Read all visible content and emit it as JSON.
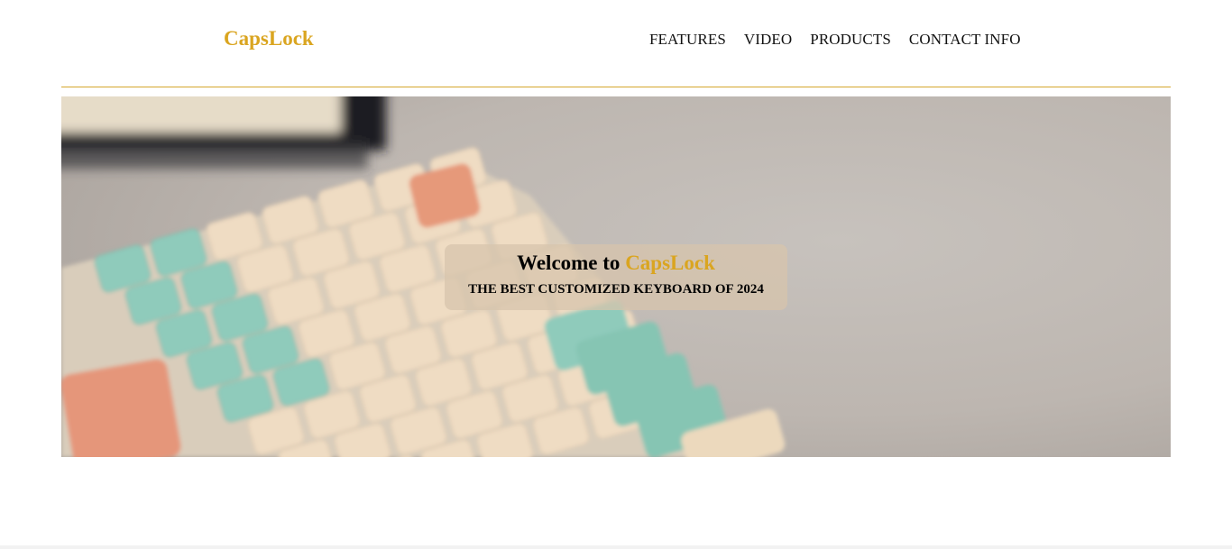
{
  "header": {
    "logo": "CapsLock",
    "nav": [
      {
        "label": "FEATURES"
      },
      {
        "label": "VIDEO"
      },
      {
        "label": "PRODUCTS"
      },
      {
        "label": "CONTACT INFO"
      }
    ]
  },
  "hero": {
    "title_prefix": "Welcome to",
    "title_brand": "CapsLock",
    "subtitle": "THE BEST CUSTOMIZED KEYBOARD OF 2024"
  },
  "colors": {
    "accent": "#daa520",
    "divider": "#d4a72c",
    "text": "#111111"
  }
}
